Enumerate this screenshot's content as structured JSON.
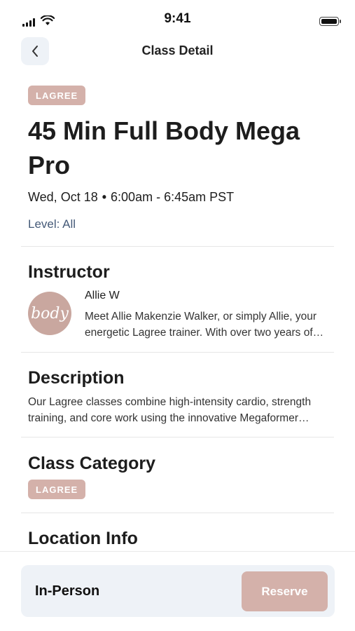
{
  "status_bar": {
    "time": "9:41",
    "icons": [
      "signal-icon",
      "wifi-icon",
      "battery-icon"
    ]
  },
  "header": {
    "title": "Class Detail",
    "back_icon": "chevron-left-icon"
  },
  "class_info": {
    "tag": "LAGREE",
    "title": "45 Min Full Body Mega Pro",
    "date": "Wed, Oct 18",
    "separator": "•",
    "time_range": "6:00am - 6:45am PST",
    "level": "Level: All"
  },
  "instructor": {
    "section_title": "Instructor",
    "avatar_text": "body",
    "name": "Allie W",
    "bio": "Meet Allie Makenzie Walker, or simply Allie, your energetic Lagree trainer. With over two years of experience"
  },
  "description": {
    "section_title": "Description",
    "text": "Our Lagree classes combine high-intensity cardio, strength training, and core work using the innovative Megaformer machine"
  },
  "category": {
    "section_title": "Class Category",
    "tag": "LAGREE"
  },
  "location": {
    "section_title": "Location Info"
  },
  "booking": {
    "type": "In-Person",
    "reserve_label": "Reserve"
  },
  "colors": {
    "accent": "#d4b1aa",
    "card_bg": "#eef2f7",
    "level_text": "#455a78"
  }
}
